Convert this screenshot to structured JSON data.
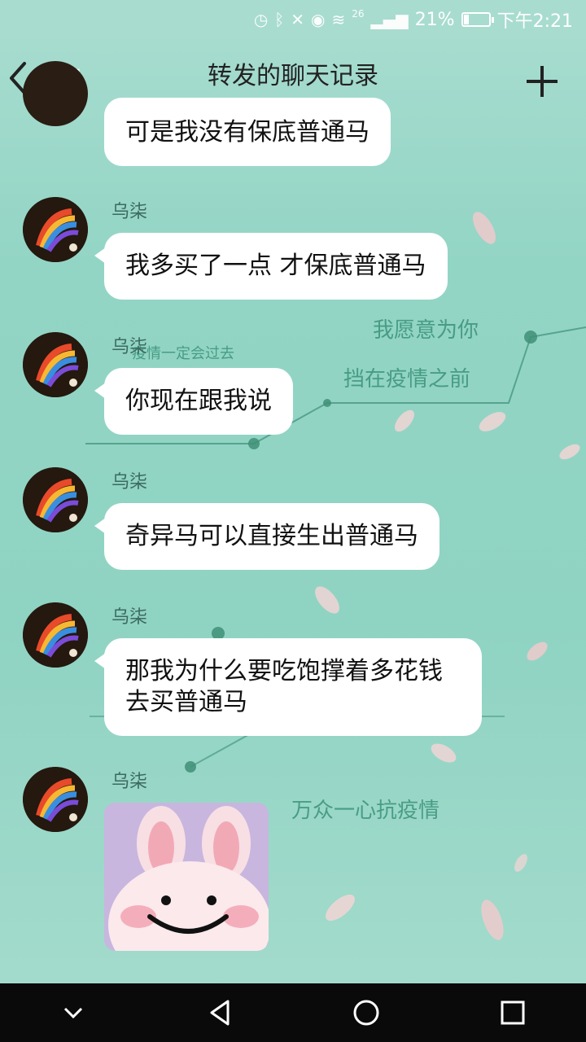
{
  "status_bar": {
    "network_label": "26",
    "battery_percent": "21%",
    "time": "下午2:21",
    "battery_level": 0.21
  },
  "header": {
    "back_label": "返回",
    "title": "转发的聊天记录"
  },
  "messages": [
    {
      "sender": "",
      "text": "可是我没有保底普通马"
    },
    {
      "sender": "乌柒",
      "text": "我多买了一点 才保底普通马"
    },
    {
      "sender": "乌柒",
      "text": "你现在跟我说"
    },
    {
      "sender": "乌柒",
      "text": "奇异马可以直接生出普通马"
    },
    {
      "sender": "乌柒",
      "text": "那我为什么要吃饱撑着多花钱去买普通马"
    },
    {
      "sender": "乌柒",
      "type": "sticker",
      "sticker_icon": "bunny-face-icon"
    }
  ],
  "background_text": {
    "line1": "我愿意为你",
    "line2": "挡在疫情之前",
    "line3": "疫情一定会过去",
    "line4": "万众一心抗疫情"
  },
  "colors": {
    "background": "#93d5c5",
    "bubble": "#ffffff",
    "nav_bar": "#0a0a0a"
  }
}
